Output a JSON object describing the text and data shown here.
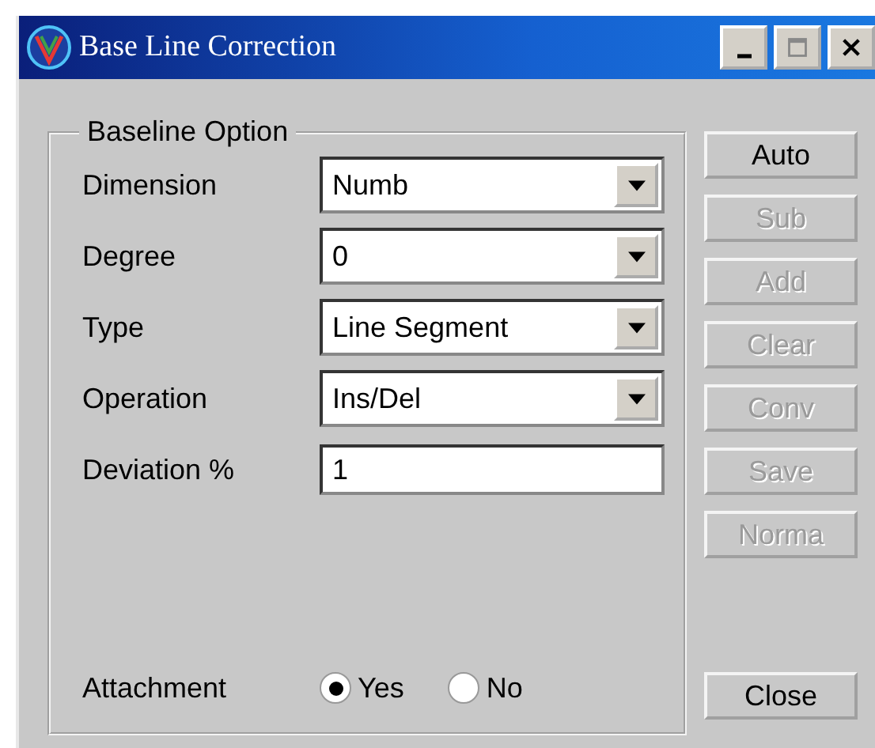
{
  "window": {
    "title": "Base Line Correction"
  },
  "group": {
    "title": "Baseline Option"
  },
  "fields": [
    {
      "kind": "dropdown",
      "label": "Dimension",
      "value": "Numb"
    },
    {
      "kind": "dropdown",
      "label": "Degree",
      "value": "0"
    },
    {
      "kind": "dropdown",
      "label": "Type",
      "value": "Line Segment"
    },
    {
      "kind": "dropdown",
      "label": "Operation",
      "value": "Ins/Del"
    },
    {
      "kind": "text",
      "label": "Deviation %",
      "value": "1"
    },
    {
      "kind": "radio",
      "label": "Attachment",
      "options": [
        {
          "label": "Yes",
          "selected": true
        },
        {
          "label": "No",
          "selected": false
        }
      ]
    }
  ],
  "buttons": [
    {
      "label": "Auto",
      "disabled": false
    },
    {
      "label": "Sub",
      "disabled": true
    },
    {
      "label": "Add",
      "disabled": true
    },
    {
      "label": "Clear",
      "disabled": true
    },
    {
      "label": "Conv",
      "disabled": true
    },
    {
      "label": "Save",
      "disabled": true
    },
    {
      "label": "Norma",
      "disabled": true
    }
  ],
  "close_button": {
    "label": "Close",
    "disabled": false
  }
}
